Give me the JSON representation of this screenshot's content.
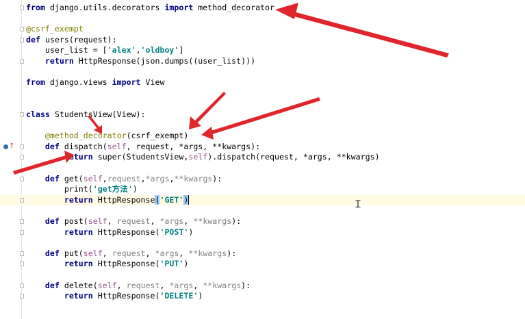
{
  "lines": [
    [
      {
        "t": "from",
        "c": "kw"
      },
      {
        "t": " django.utils.decorators "
      },
      {
        "t": "import",
        "c": "kw"
      },
      {
        "t": " method_decorator"
      }
    ],
    [],
    [
      {
        "t": "@csrf_exempt",
        "c": "dec"
      }
    ],
    [
      {
        "t": "def",
        "c": "kw"
      },
      {
        "t": " users(request):"
      }
    ],
    [
      {
        "t": "    user_list = ["
      },
      {
        "t": "'alex'",
        "c": "str"
      },
      {
        "t": ","
      },
      {
        "t": "'oldboy'",
        "c": "str"
      },
      {
        "t": "]"
      }
    ],
    [
      {
        "t": "    "
      },
      {
        "t": "return",
        "c": "kw"
      },
      {
        "t": " HttpResponse(json.dumps((user_list)))"
      }
    ],
    [],
    [
      {
        "t": "from",
        "c": "kw"
      },
      {
        "t": " django.views "
      },
      {
        "t": "import",
        "c": "kw"
      },
      {
        "t": " View"
      }
    ],
    [],
    [],
    [
      {
        "t": "class",
        "c": "kw"
      },
      {
        "t": " StudentsView(View):"
      }
    ],
    [],
    [
      {
        "t": "    "
      },
      {
        "t": "@method_decorator",
        "c": "dec"
      },
      {
        "t": "(csrf_exempt)"
      }
    ],
    [
      {
        "t": "    "
      },
      {
        "t": "def",
        "c": "kw"
      },
      {
        "t": " dispatch("
      },
      {
        "t": "self",
        "c": "param"
      },
      {
        "t": ", request, *args, **kwargs):"
      }
    ],
    [
      {
        "t": "        "
      },
      {
        "t": "return",
        "c": "kw"
      },
      {
        "t": " super(StudentsView,"
      },
      {
        "t": "self",
        "c": "param"
      },
      {
        "t": ").dispatch(request, *args, **kwargs)"
      }
    ],
    [],
    [
      {
        "t": "    "
      },
      {
        "t": "def",
        "c": "kw"
      },
      {
        "t": " get("
      },
      {
        "t": "self",
        "c": "param"
      },
      {
        "t": ","
      },
      {
        "t": "request",
        "c": "muted"
      },
      {
        "t": ","
      },
      {
        "t": "*args",
        "c": "muted"
      },
      {
        "t": ","
      },
      {
        "t": "**kwargs",
        "c": "muted"
      },
      {
        "t": "):"
      }
    ],
    [
      {
        "t": "        print("
      },
      {
        "t": "'get方法'",
        "c": "str"
      },
      {
        "t": ")"
      }
    ],
    [
      {
        "t": "        "
      },
      {
        "t": "return",
        "c": "kw"
      },
      {
        "t": " HttpResponse"
      },
      {
        "t": "(",
        "c": "hl"
      },
      {
        "t": "'GET'",
        "c": "str"
      },
      {
        "t": ")",
        "c": "hl"
      },
      {
        "t": "",
        "c": "caret"
      }
    ],
    [],
    [
      {
        "t": "    "
      },
      {
        "t": "def",
        "c": "kw"
      },
      {
        "t": " post("
      },
      {
        "t": "self",
        "c": "param"
      },
      {
        "t": ", "
      },
      {
        "t": "request",
        "c": "muted"
      },
      {
        "t": ", "
      },
      {
        "t": "*args",
        "c": "muted"
      },
      {
        "t": ", "
      },
      {
        "t": "**kwargs",
        "c": "muted"
      },
      {
        "t": "):"
      }
    ],
    [
      {
        "t": "        "
      },
      {
        "t": "return",
        "c": "kw"
      },
      {
        "t": " HttpResponse("
      },
      {
        "t": "'POST'",
        "c": "str"
      },
      {
        "t": ")"
      }
    ],
    [],
    [
      {
        "t": "    "
      },
      {
        "t": "def",
        "c": "kw"
      },
      {
        "t": " put("
      },
      {
        "t": "self",
        "c": "param"
      },
      {
        "t": ", "
      },
      {
        "t": "request",
        "c": "muted"
      },
      {
        "t": ", "
      },
      {
        "t": "*args",
        "c": "muted"
      },
      {
        "t": ", "
      },
      {
        "t": "**kwargs",
        "c": "muted"
      },
      {
        "t": "):"
      }
    ],
    [
      {
        "t": "        "
      },
      {
        "t": "return",
        "c": "kw"
      },
      {
        "t": " HttpResponse("
      },
      {
        "t": "'PUT'",
        "c": "str"
      },
      {
        "t": ")"
      }
    ],
    [],
    [
      {
        "t": "    "
      },
      {
        "t": "def",
        "c": "kw"
      },
      {
        "t": " delete("
      },
      {
        "t": "self",
        "c": "param"
      },
      {
        "t": ", "
      },
      {
        "t": "request",
        "c": "muted"
      },
      {
        "t": ", "
      },
      {
        "t": "*args",
        "c": "muted"
      },
      {
        "t": ", "
      },
      {
        "t": "**kwargs",
        "c": "muted"
      },
      {
        "t": "):"
      }
    ],
    [
      {
        "t": "        "
      },
      {
        "t": "return",
        "c": "kw"
      },
      {
        "t": " HttpResponse("
      },
      {
        "t": "'DELETE'",
        "c": "str"
      },
      {
        "t": ")"
      }
    ]
  ],
  "current_line_index": 18,
  "fold_markers": [
    0,
    2,
    3,
    5,
    10,
    13,
    14,
    16,
    18,
    20,
    21,
    23,
    24,
    26,
    27
  ],
  "annotation_color": "#e0262b",
  "icons": {
    "breakpoint": "override-method-icon",
    "up": "overrides-up-arrow-icon",
    "cursor": "text-cursor-icon"
  }
}
